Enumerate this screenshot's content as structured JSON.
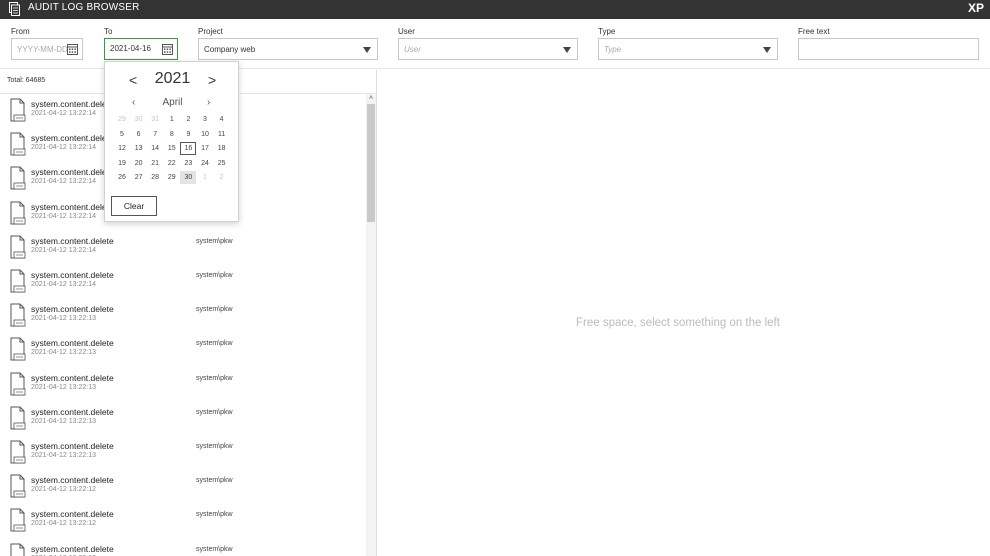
{
  "app": {
    "title": "AUDIT LOG BROWSER",
    "logo": "XP",
    "icon": "document-stack-icon"
  },
  "filters": {
    "from": {
      "label": "From",
      "placeholder": "YYYY-MM-DD",
      "value": ""
    },
    "to": {
      "label": "To",
      "value": "2021-04-16"
    },
    "project": {
      "label": "Project",
      "value": "Company web"
    },
    "user": {
      "label": "User",
      "placeholder": "User"
    },
    "type": {
      "label": "Type",
      "placeholder": "Type"
    },
    "free_text": {
      "label": "Free text",
      "value": ""
    }
  },
  "list": {
    "total": "Total: 64685",
    "rows": [
      {
        "title": "system.content.delete",
        "time": "2021-04-12 13:22:14",
        "user": ""
      },
      {
        "title": "system.content.delete",
        "time": "2021-04-12 13:22:14",
        "user": ""
      },
      {
        "title": "system.content.delete",
        "time": "2021-04-12 13:22:14",
        "user": ""
      },
      {
        "title": "system.content.delete",
        "time": "2021-04-12 13:22:14",
        "user": ""
      },
      {
        "title": "system.content.delete",
        "time": "2021-04-12 13:22:14",
        "user": "system\\pkw"
      },
      {
        "title": "system.content.delete",
        "time": "2021-04-12 13:22:14",
        "user": "system\\pkw"
      },
      {
        "title": "system.content.delete",
        "time": "2021-04-12 13:22:13",
        "user": "system\\pkw"
      },
      {
        "title": "system.content.delete",
        "time": "2021-04-12 13:22:13",
        "user": "system\\pkw"
      },
      {
        "title": "system.content.delete",
        "time": "2021-04-12 13:22:13",
        "user": "system\\pkw"
      },
      {
        "title": "system.content.delete",
        "time": "2021-04-12 13:22:13",
        "user": "system\\pkw"
      },
      {
        "title": "system.content.delete",
        "time": "2021-04-12 13:22:13",
        "user": "system\\pkw"
      },
      {
        "title": "system.content.delete",
        "time": "2021-04-12 13:22:12",
        "user": "system\\pkw"
      },
      {
        "title": "system.content.delete",
        "time": "2021-04-12 13:22:12",
        "user": "system\\pkw"
      },
      {
        "title": "system.content.delete",
        "time": "2021-04-12 13:22:12",
        "user": "system\\pkw"
      }
    ]
  },
  "detail": {
    "empty_message": "Free space, select something on the left"
  },
  "datepicker": {
    "year": "2021",
    "month": "April",
    "prev": "‹",
    "next": "›",
    "clear_label": "Clear",
    "selected_day": "16",
    "today_day": "30",
    "weeks": [
      [
        "29",
        "30",
        "31",
        "1",
        "2",
        "3",
        "4"
      ],
      [
        "5",
        "6",
        "7",
        "8",
        "9",
        "10",
        "11"
      ],
      [
        "12",
        "13",
        "14",
        "15",
        "16",
        "17",
        "18"
      ],
      [
        "19",
        "20",
        "21",
        "22",
        "23",
        "24",
        "25"
      ],
      [
        "26",
        "27",
        "28",
        "29",
        "30",
        "1",
        "2"
      ]
    ],
    "muted": [
      [
        0,
        0
      ],
      [
        0,
        1
      ],
      [
        0,
        2
      ],
      [
        4,
        5
      ],
      [
        4,
        6
      ]
    ]
  }
}
